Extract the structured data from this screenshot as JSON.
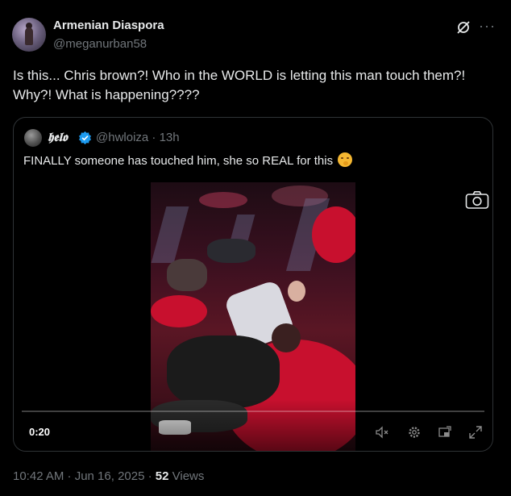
{
  "author": {
    "display_name": "Armenian Diaspora",
    "handle": "@meganurban58"
  },
  "tweet": {
    "text": "Is this... Chris brown?! Who in the WORLD is letting this man touch them?! Why?! What is happening????"
  },
  "quote": {
    "display_name": "𝖍𝖊𝖑𝖔",
    "handle_time": "@hwloiza · 13h",
    "text": "FINALLY someone has touched him, she so REAL for this",
    "emoji": "smirking-face"
  },
  "video": {
    "time": "0:20"
  },
  "footer": {
    "timestamp": "10:42 AM · Jun 16, 2025 · ",
    "views_count": "52",
    "views_label": " Views"
  },
  "colors": {
    "background": "#000000",
    "text": "#e7e9ea",
    "muted": "#71767b",
    "border": "#2f3336",
    "verified": "#1d9bf0"
  }
}
